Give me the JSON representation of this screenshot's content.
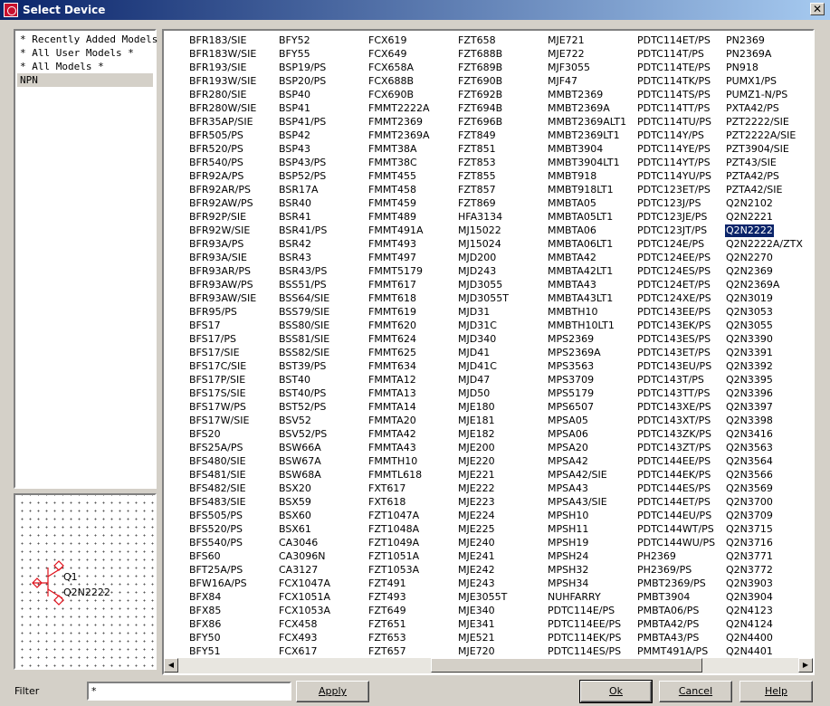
{
  "window": {
    "title": "Select Device",
    "close_symbol": "✕"
  },
  "model_list": {
    "items": [
      "* Recently Added Models *",
      "* All User Models *",
      "* All Models *",
      "NPN"
    ],
    "selected_index": 3
  },
  "preview": {
    "refdes": "Q1",
    "model": "Q2N2222"
  },
  "devices": {
    "selected": "Q2N2222",
    "columns": [
      [
        "BFR183/SIE",
        "BFR183W/SIE",
        "BFR193/SIE",
        "BFR193W/SIE",
        "BFR280/SIE",
        "BFR280W/SIE",
        "BFR35AP/SIE",
        "BFR505/PS",
        "BFR520/PS",
        "BFR540/PS",
        "BFR92A/PS",
        "BFR92AR/PS",
        "BFR92AW/PS",
        "BFR92P/SIE",
        "BFR92W/SIE",
        "BFR93A/PS",
        "BFR93A/SIE",
        "BFR93AR/PS",
        "BFR93AW/PS",
        "BFR93AW/SIE",
        "BFR95/PS",
        "BFS17",
        "BFS17/PS",
        "BFS17/SIE",
        "BFS17C/SIE",
        "BFS17P/SIE",
        "BFS17S/SIE",
        "BFS17W/PS",
        "BFS17W/SIE",
        "BFS20",
        "BFS25A/PS",
        "BFS480/SIE",
        "BFS481/SIE",
        "BFS482/SIE",
        "BFS483/SIE",
        "BFS505/PS",
        "BFS520/PS",
        "BFS540/PS",
        "BFS60",
        "BFT25A/PS",
        "BFW16A/PS",
        "BFX84",
        "BFX85",
        "BFX86",
        "BFY50",
        "BFY51"
      ],
      [
        "BFY52",
        "BFY55",
        "BSP19/PS",
        "BSP20/PS",
        "BSP40",
        "BSP41",
        "BSP41/PS",
        "BSP42",
        "BSP43",
        "BSP43/PS",
        "BSP52/PS",
        "BSR17A",
        "BSR40",
        "BSR41",
        "BSR41/PS",
        "BSR42",
        "BSR43",
        "BSR43/PS",
        "BSS51/PS",
        "BSS64/SIE",
        "BSS79/SIE",
        "BSS80/SIE",
        "BSS81/SIE",
        "BSS82/SIE",
        "BST39/PS",
        "BST40",
        "BST40/PS",
        "BST52/PS",
        "BSV52",
        "BSV52/PS",
        "BSW66A",
        "BSW67A",
        "BSW68A",
        "BSX20",
        "BSX59",
        "BSX60",
        "BSX61",
        "CA3046",
        "CA3096N",
        "CA3127",
        "FCX1047A",
        "FCX1051A",
        "FCX1053A",
        "FCX458",
        "FCX493",
        "FCX617"
      ],
      [
        "FCX619",
        "FCX649",
        "FCX658A",
        "FCX688B",
        "FCX690B",
        "FMMT2222A",
        "FMMT2369",
        "FMMT2369A",
        "FMMT38A",
        "FMMT38C",
        "FMMT455",
        "FMMT458",
        "FMMT459",
        "FMMT489",
        "FMMT491A",
        "FMMT493",
        "FMMT497",
        "FMMT5179",
        "FMMT617",
        "FMMT618",
        "FMMT619",
        "FMMT620",
        "FMMT624",
        "FMMT625",
        "FMMT634",
        "FMMTA12",
        "FMMTA13",
        "FMMTA14",
        "FMMTA20",
        "FMMTA42",
        "FMMTA43",
        "FMMTH10",
        "FMMTL618",
        "FXT617",
        "FXT618",
        "FZT1047A",
        "FZT1048A",
        "FZT1049A",
        "FZT1051A",
        "FZT1053A",
        "FZT491",
        "FZT493",
        "FZT649",
        "FZT651",
        "FZT653",
        "FZT657"
      ],
      [
        "FZT658",
        "FZT688B",
        "FZT689B",
        "FZT690B",
        "FZT692B",
        "FZT694B",
        "FZT696B",
        "FZT849",
        "FZT851",
        "FZT853",
        "FZT855",
        "FZT857",
        "FZT869",
        "HFA3134",
        "MJ15022",
        "MJ15024",
        "MJD200",
        "MJD243",
        "MJD3055",
        "MJD3055T",
        "MJD31",
        "MJD31C",
        "MJD340",
        "MJD41",
        "MJD41C",
        "MJD47",
        "MJD50",
        "MJE180",
        "MJE181",
        "MJE182",
        "MJE200",
        "MJE220",
        "MJE221",
        "MJE222",
        "MJE223",
        "MJE224",
        "MJE225",
        "MJE240",
        "MJE241",
        "MJE242",
        "MJE243",
        "MJE3055T",
        "MJE340",
        "MJE341",
        "MJE521",
        "MJE720"
      ],
      [
        "MJE721",
        "MJE722",
        "MJF3055",
        "MJF47",
        "MMBT2369",
        "MMBT2369A",
        "MMBT2369ALT1",
        "MMBT2369LT1",
        "MMBT3904",
        "MMBT3904LT1",
        "MMBT918",
        "MMBT918LT1",
        "MMBTA05",
        "MMBTA05LT1",
        "MMBTA06",
        "MMBTA06LT1",
        "MMBTA42",
        "MMBTA42LT1",
        "MMBTA43",
        "MMBTA43LT1",
        "MMBTH10",
        "MMBTH10LT1",
        "MPS2369",
        "MPS2369A",
        "MPS3563",
        "MPS3709",
        "MPS5179",
        "MPS6507",
        "MPSA05",
        "MPSA06",
        "MPSA20",
        "MPSA42",
        "MPSA42/SIE",
        "MPSA43",
        "MPSA43/SIE",
        "MPSH10",
        "MPSH11",
        "MPSH19",
        "MPSH24",
        "MPSH32",
        "MPSH34",
        "NUHFARRY",
        "PDTC114E/PS",
        "PDTC114EE/PS",
        "PDTC114EK/PS",
        "PDTC114ES/PS"
      ],
      [
        "PDTC114ET/PS",
        "PDTC114T/PS",
        "PDTC114TE/PS",
        "PDTC114TK/PS",
        "PDTC114TS/PS",
        "PDTC114TT/PS",
        "PDTC114TU/PS",
        "PDTC114Y/PS",
        "PDTC114YE/PS",
        "PDTC114YT/PS",
        "PDTC114YU/PS",
        "PDTC123ET/PS",
        "PDTC123J/PS",
        "PDTC123JE/PS",
        "PDTC123JT/PS",
        "PDTC124E/PS",
        "PDTC124EE/PS",
        "PDTC124ES/PS",
        "PDTC124ET/PS",
        "PDTC124XE/PS",
        "PDTC143EE/PS",
        "PDTC143EK/PS",
        "PDTC143ES/PS",
        "PDTC143ET/PS",
        "PDTC143EU/PS",
        "PDTC143T/PS",
        "PDTC143TT/PS",
        "PDTC143XE/PS",
        "PDTC143XT/PS",
        "PDTC143ZK/PS",
        "PDTC143ZT/PS",
        "PDTC144EE/PS",
        "PDTC144EK/PS",
        "PDTC144ES/PS",
        "PDTC144ET/PS",
        "PDTC144EU/PS",
        "PDTC144WT/PS",
        "PDTC144WU/PS",
        "PH2369",
        "PH2369/PS",
        "PMBT2369/PS",
        "PMBT3904",
        "PMBTA06/PS",
        "PMBTA42/PS",
        "PMBTA43/PS",
        "PMMT491A/PS"
      ],
      [
        "PN2369",
        "PN2369A",
        "PN918",
        "PUMX1/PS",
        "PUMZ1-N/PS",
        "PXTA42/PS",
        "PZT2222/SIE",
        "PZT2222A/SIE",
        "PZT3904/SIE",
        "PZT43/SIE",
        "PZTA42/PS",
        "PZTA42/SIE",
        "Q2N2102",
        "Q2N2221",
        "Q2N2222",
        "Q2N2222A/ZTX",
        "Q2N2270",
        "Q2N2369",
        "Q2N2369A",
        "Q2N3019",
        "Q2N3053",
        "Q2N3055",
        "Q2N3390",
        "Q2N3391",
        "Q2N3392",
        "Q2N3395",
        "Q2N3396",
        "Q2N3397",
        "Q2N3398",
        "Q2N3416",
        "Q2N3563",
        "Q2N3564",
        "Q2N3566",
        "Q2N3569",
        "Q2N3700",
        "Q2N3709",
        "Q2N3715",
        "Q2N3716",
        "Q2N3771",
        "Q2N3772",
        "Q2N3903",
        "Q2N3904",
        "Q2N4123",
        "Q2N4124",
        "Q2N4400",
        "Q2N4401"
      ]
    ]
  },
  "scrollbar": {
    "left_arrow": "◀",
    "right_arrow": "▶"
  },
  "filter": {
    "label": "Filter",
    "value": "*"
  },
  "buttons": {
    "apply": "Apply",
    "ok": "Ok",
    "cancel": "Cancel",
    "help": "Help"
  }
}
